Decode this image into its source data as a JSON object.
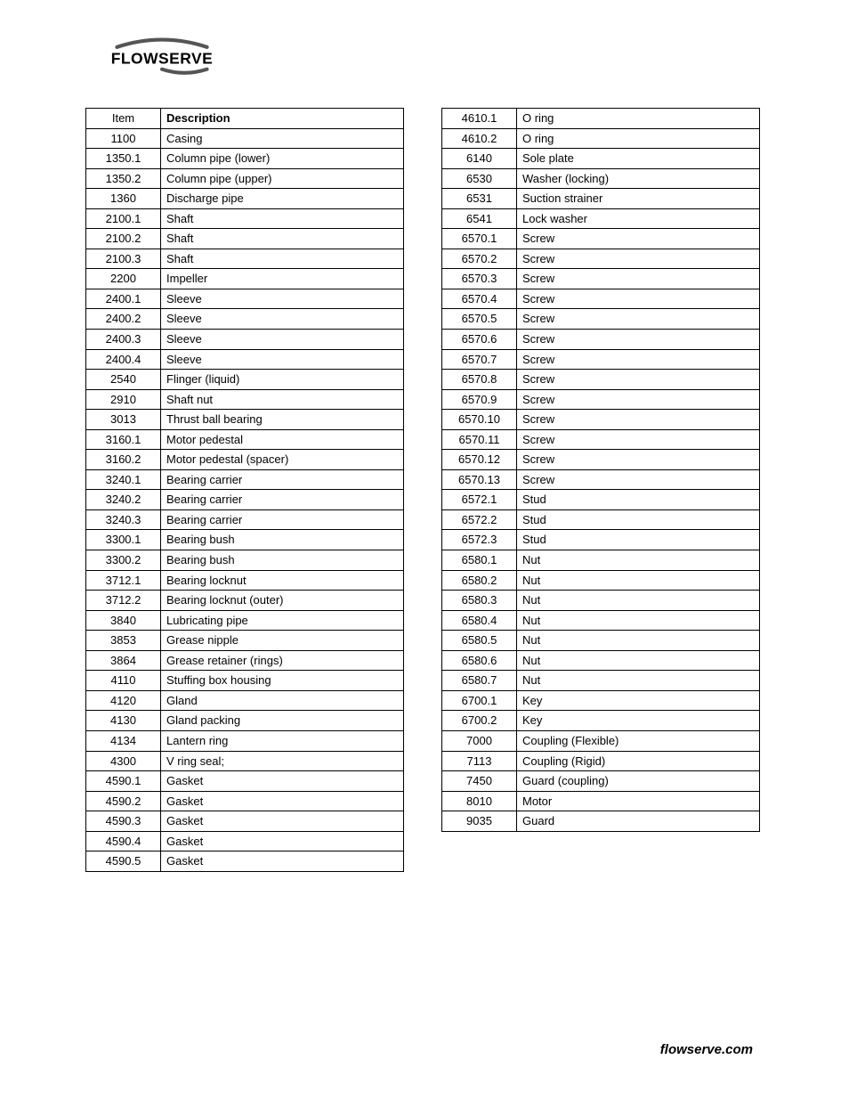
{
  "brand": "FLOWSERVE",
  "footer": "flowserve.com",
  "header": {
    "item": "Item",
    "description": "Description"
  },
  "left_rows": [
    {
      "item": "1100",
      "desc": "Casing"
    },
    {
      "item": "1350.1",
      "desc": "Column pipe (lower)"
    },
    {
      "item": "1350.2",
      "desc": "Column pipe (upper)"
    },
    {
      "item": "1360",
      "desc": "Discharge pipe"
    },
    {
      "item": "2100.1",
      "desc": "Shaft"
    },
    {
      "item": "2100.2",
      "desc": "Shaft"
    },
    {
      "item": "2100.3",
      "desc": "Shaft"
    },
    {
      "item": "2200",
      "desc": "Impeller"
    },
    {
      "item": "2400.1",
      "desc": "Sleeve"
    },
    {
      "item": "2400.2",
      "desc": "Sleeve"
    },
    {
      "item": "2400.3",
      "desc": "Sleeve"
    },
    {
      "item": "2400.4",
      "desc": "Sleeve"
    },
    {
      "item": "2540",
      "desc": "Flinger (liquid)"
    },
    {
      "item": "2910",
      "desc": "Shaft nut"
    },
    {
      "item": "3013",
      "desc": "Thrust ball bearing"
    },
    {
      "item": "3160.1",
      "desc": "Motor pedestal"
    },
    {
      "item": "3160.2",
      "desc": "Motor pedestal (spacer)"
    },
    {
      "item": "3240.1",
      "desc": "Bearing carrier"
    },
    {
      "item": "3240.2",
      "desc": "Bearing carrier"
    },
    {
      "item": "3240.3",
      "desc": "Bearing carrier"
    },
    {
      "item": "3300.1",
      "desc": "Bearing bush"
    },
    {
      "item": "3300.2",
      "desc": "Bearing bush"
    },
    {
      "item": "3712.1",
      "desc": "Bearing locknut"
    },
    {
      "item": "3712.2",
      "desc": "Bearing locknut (outer)"
    },
    {
      "item": "3840",
      "desc": "Lubricating pipe"
    },
    {
      "item": "3853",
      "desc": "Grease nipple"
    },
    {
      "item": "3864",
      "desc": "Grease retainer (rings)"
    },
    {
      "item": "4110",
      "desc": "Stuffing box housing"
    },
    {
      "item": "4120",
      "desc": "Gland"
    },
    {
      "item": "4130",
      "desc": "Gland packing"
    },
    {
      "item": "4134",
      "desc": "Lantern ring"
    },
    {
      "item": "4300",
      "desc": "V ring seal;"
    },
    {
      "item": "4590.1",
      "desc": "Gasket"
    },
    {
      "item": "4590.2",
      "desc": "Gasket"
    },
    {
      "item": "4590.3",
      "desc": "Gasket"
    },
    {
      "item": "4590.4",
      "desc": "Gasket"
    },
    {
      "item": "4590.5",
      "desc": "Gasket"
    }
  ],
  "right_rows": [
    {
      "item": "4610.1",
      "desc": "O ring"
    },
    {
      "item": "4610.2",
      "desc": "O ring"
    },
    {
      "item": "6140",
      "desc": "Sole plate"
    },
    {
      "item": "6530",
      "desc": "Washer (locking)"
    },
    {
      "item": "6531",
      "desc": "Suction strainer"
    },
    {
      "item": "6541",
      "desc": "Lock washer"
    },
    {
      "item": "6570.1",
      "desc": "Screw"
    },
    {
      "item": "6570.2",
      "desc": "Screw"
    },
    {
      "item": "6570.3",
      "desc": "Screw"
    },
    {
      "item": "6570.4",
      "desc": "Screw"
    },
    {
      "item": "6570.5",
      "desc": "Screw"
    },
    {
      "item": "6570.6",
      "desc": "Screw"
    },
    {
      "item": "6570.7",
      "desc": "Screw"
    },
    {
      "item": "6570.8",
      "desc": "Screw"
    },
    {
      "item": "6570.9",
      "desc": "Screw"
    },
    {
      "item": "6570.10",
      "desc": "Screw"
    },
    {
      "item": "6570.11",
      "desc": "Screw"
    },
    {
      "item": "6570.12",
      "desc": "Screw"
    },
    {
      "item": "6570.13",
      "desc": "Screw"
    },
    {
      "item": "6572.1",
      "desc": "Stud"
    },
    {
      "item": "6572.2",
      "desc": "Stud"
    },
    {
      "item": "6572.3",
      "desc": "Stud"
    },
    {
      "item": "6580.1",
      "desc": "Nut"
    },
    {
      "item": "6580.2",
      "desc": "Nut"
    },
    {
      "item": "6580.3",
      "desc": "Nut"
    },
    {
      "item": "6580.4",
      "desc": "Nut"
    },
    {
      "item": "6580.5",
      "desc": "Nut"
    },
    {
      "item": "6580.6",
      "desc": "Nut"
    },
    {
      "item": "6580.7",
      "desc": "Nut"
    },
    {
      "item": "6700.1",
      "desc": "Key"
    },
    {
      "item": "6700.2",
      "desc": "Key"
    },
    {
      "item": "7000",
      "desc": "Coupling (Flexible)"
    },
    {
      "item": "7113",
      "desc": "Coupling (Rigid)"
    },
    {
      "item": "7450",
      "desc": "Guard (coupling)"
    },
    {
      "item": "8010",
      "desc": "Motor"
    },
    {
      "item": "9035",
      "desc": "Guard"
    }
  ]
}
